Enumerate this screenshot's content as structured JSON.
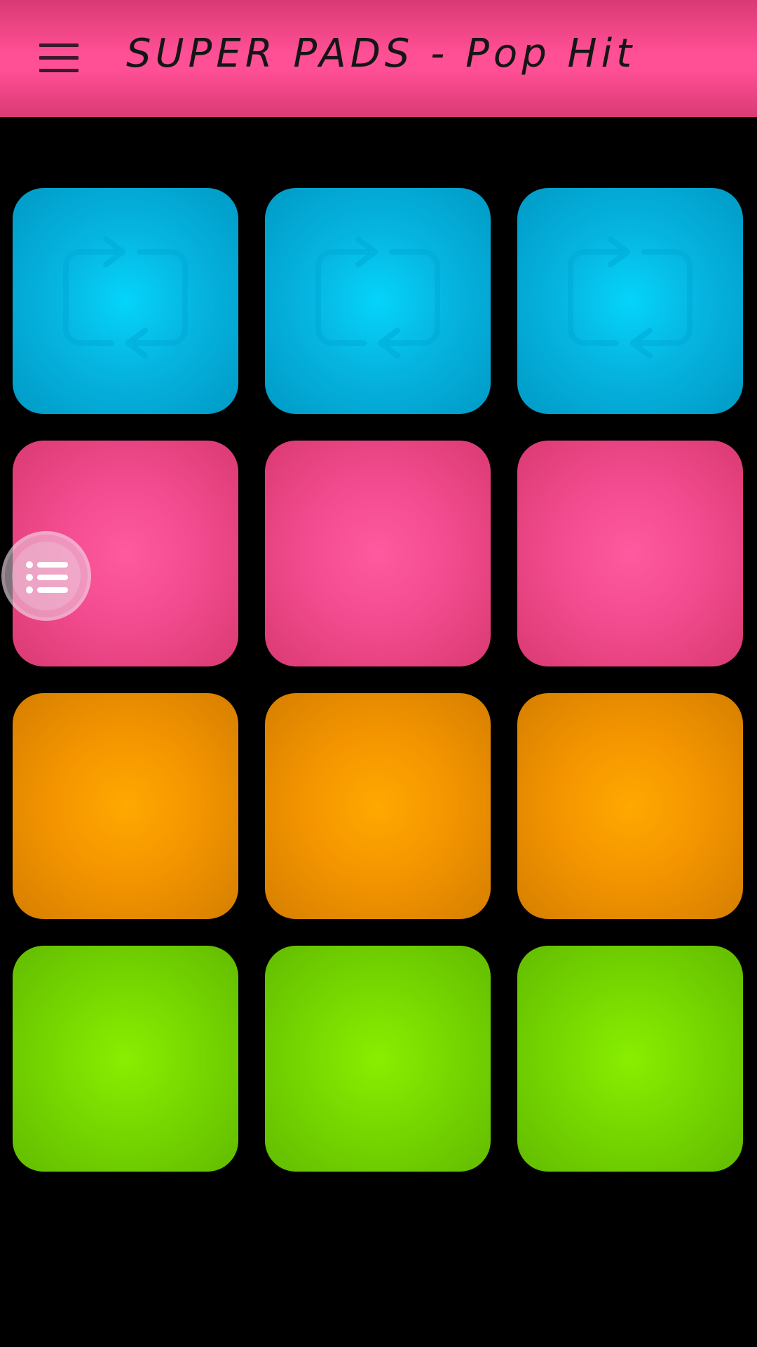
{
  "header": {
    "title": "SUPER PADS - Pop Hit",
    "menu_icon": "hamburger-menu-icon",
    "color": "#ff4f95"
  },
  "pads": [
    {
      "row": 1,
      "col": 1,
      "color": "blue",
      "icon": "loop-icon"
    },
    {
      "row": 1,
      "col": 2,
      "color": "blue",
      "icon": "loop-icon"
    },
    {
      "row": 1,
      "col": 3,
      "color": "blue",
      "icon": "loop-icon"
    },
    {
      "row": 2,
      "col": 1,
      "color": "pink",
      "icon": ""
    },
    {
      "row": 2,
      "col": 2,
      "color": "pink",
      "icon": ""
    },
    {
      "row": 2,
      "col": 3,
      "color": "pink",
      "icon": ""
    },
    {
      "row": 3,
      "col": 1,
      "color": "orange",
      "icon": ""
    },
    {
      "row": 3,
      "col": 2,
      "color": "orange",
      "icon": ""
    },
    {
      "row": 3,
      "col": 3,
      "color": "orange",
      "icon": ""
    },
    {
      "row": 4,
      "col": 1,
      "color": "green",
      "icon": ""
    },
    {
      "row": 4,
      "col": 2,
      "color": "green",
      "icon": ""
    },
    {
      "row": 4,
      "col": 3,
      "color": "green",
      "icon": ""
    }
  ],
  "colors": {
    "blue": "#06b4e0",
    "pink": "#f34b8f",
    "orange": "#f49500",
    "green": "#77d800",
    "background": "#000000"
  },
  "floating_button": {
    "icon": "list-icon"
  }
}
